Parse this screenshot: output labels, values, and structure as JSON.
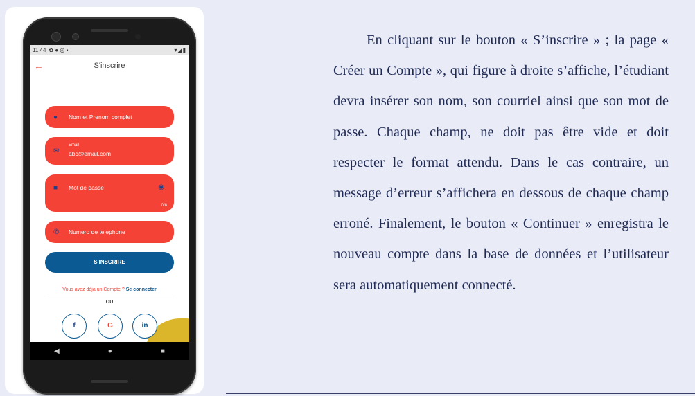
{
  "phone": {
    "status_time": "11:44",
    "status_icons": "✿ ● ◎ ▪",
    "status_right": "▾◢▮",
    "app_title": "S'inscrire",
    "fields": {
      "name_placeholder": "Nom et Prenom complet",
      "email_label": "Email",
      "email_value": "abc@email.com",
      "password_placeholder": "Mot de passe",
      "password_counter": "0/8",
      "phone_placeholder": "Numero de telephone"
    },
    "signup_button": "S'INSCRIRE",
    "login_prompt": "Vous avez déja un Compte ?",
    "login_link": "Se connecter",
    "or_label": "OU",
    "social": {
      "facebook": "f",
      "google": "G",
      "linkedin": "in"
    },
    "icons": [
      "back-arrow-icon",
      "person-icon",
      "mail-icon",
      "lock-icon",
      "eye-off-icon",
      "phone-icon"
    ]
  },
  "description": "En cliquant sur le bouton « S’inscrire » ; la page « Créer un Compte », qui figure à droite s’affiche, l’étudiant devra insérer son nom, son courriel ainsi que son mot de passe. Chaque champ, ne doit pas être vide et doit respecter le format attendu. Dans le cas contraire, un message d’erreur s’affichera en dessous de chaque champ erroné. Finalement, le bouton « Continuer » enregistra le nouveau compte dans la base de données et l’utilisateur sera automatiquement connecté.",
  "colors": {
    "accent_red": "#f44336",
    "primary_blue": "#0b5a93",
    "blob_yellow": "#dbb52a",
    "page_bg": "#e9ecf6"
  }
}
